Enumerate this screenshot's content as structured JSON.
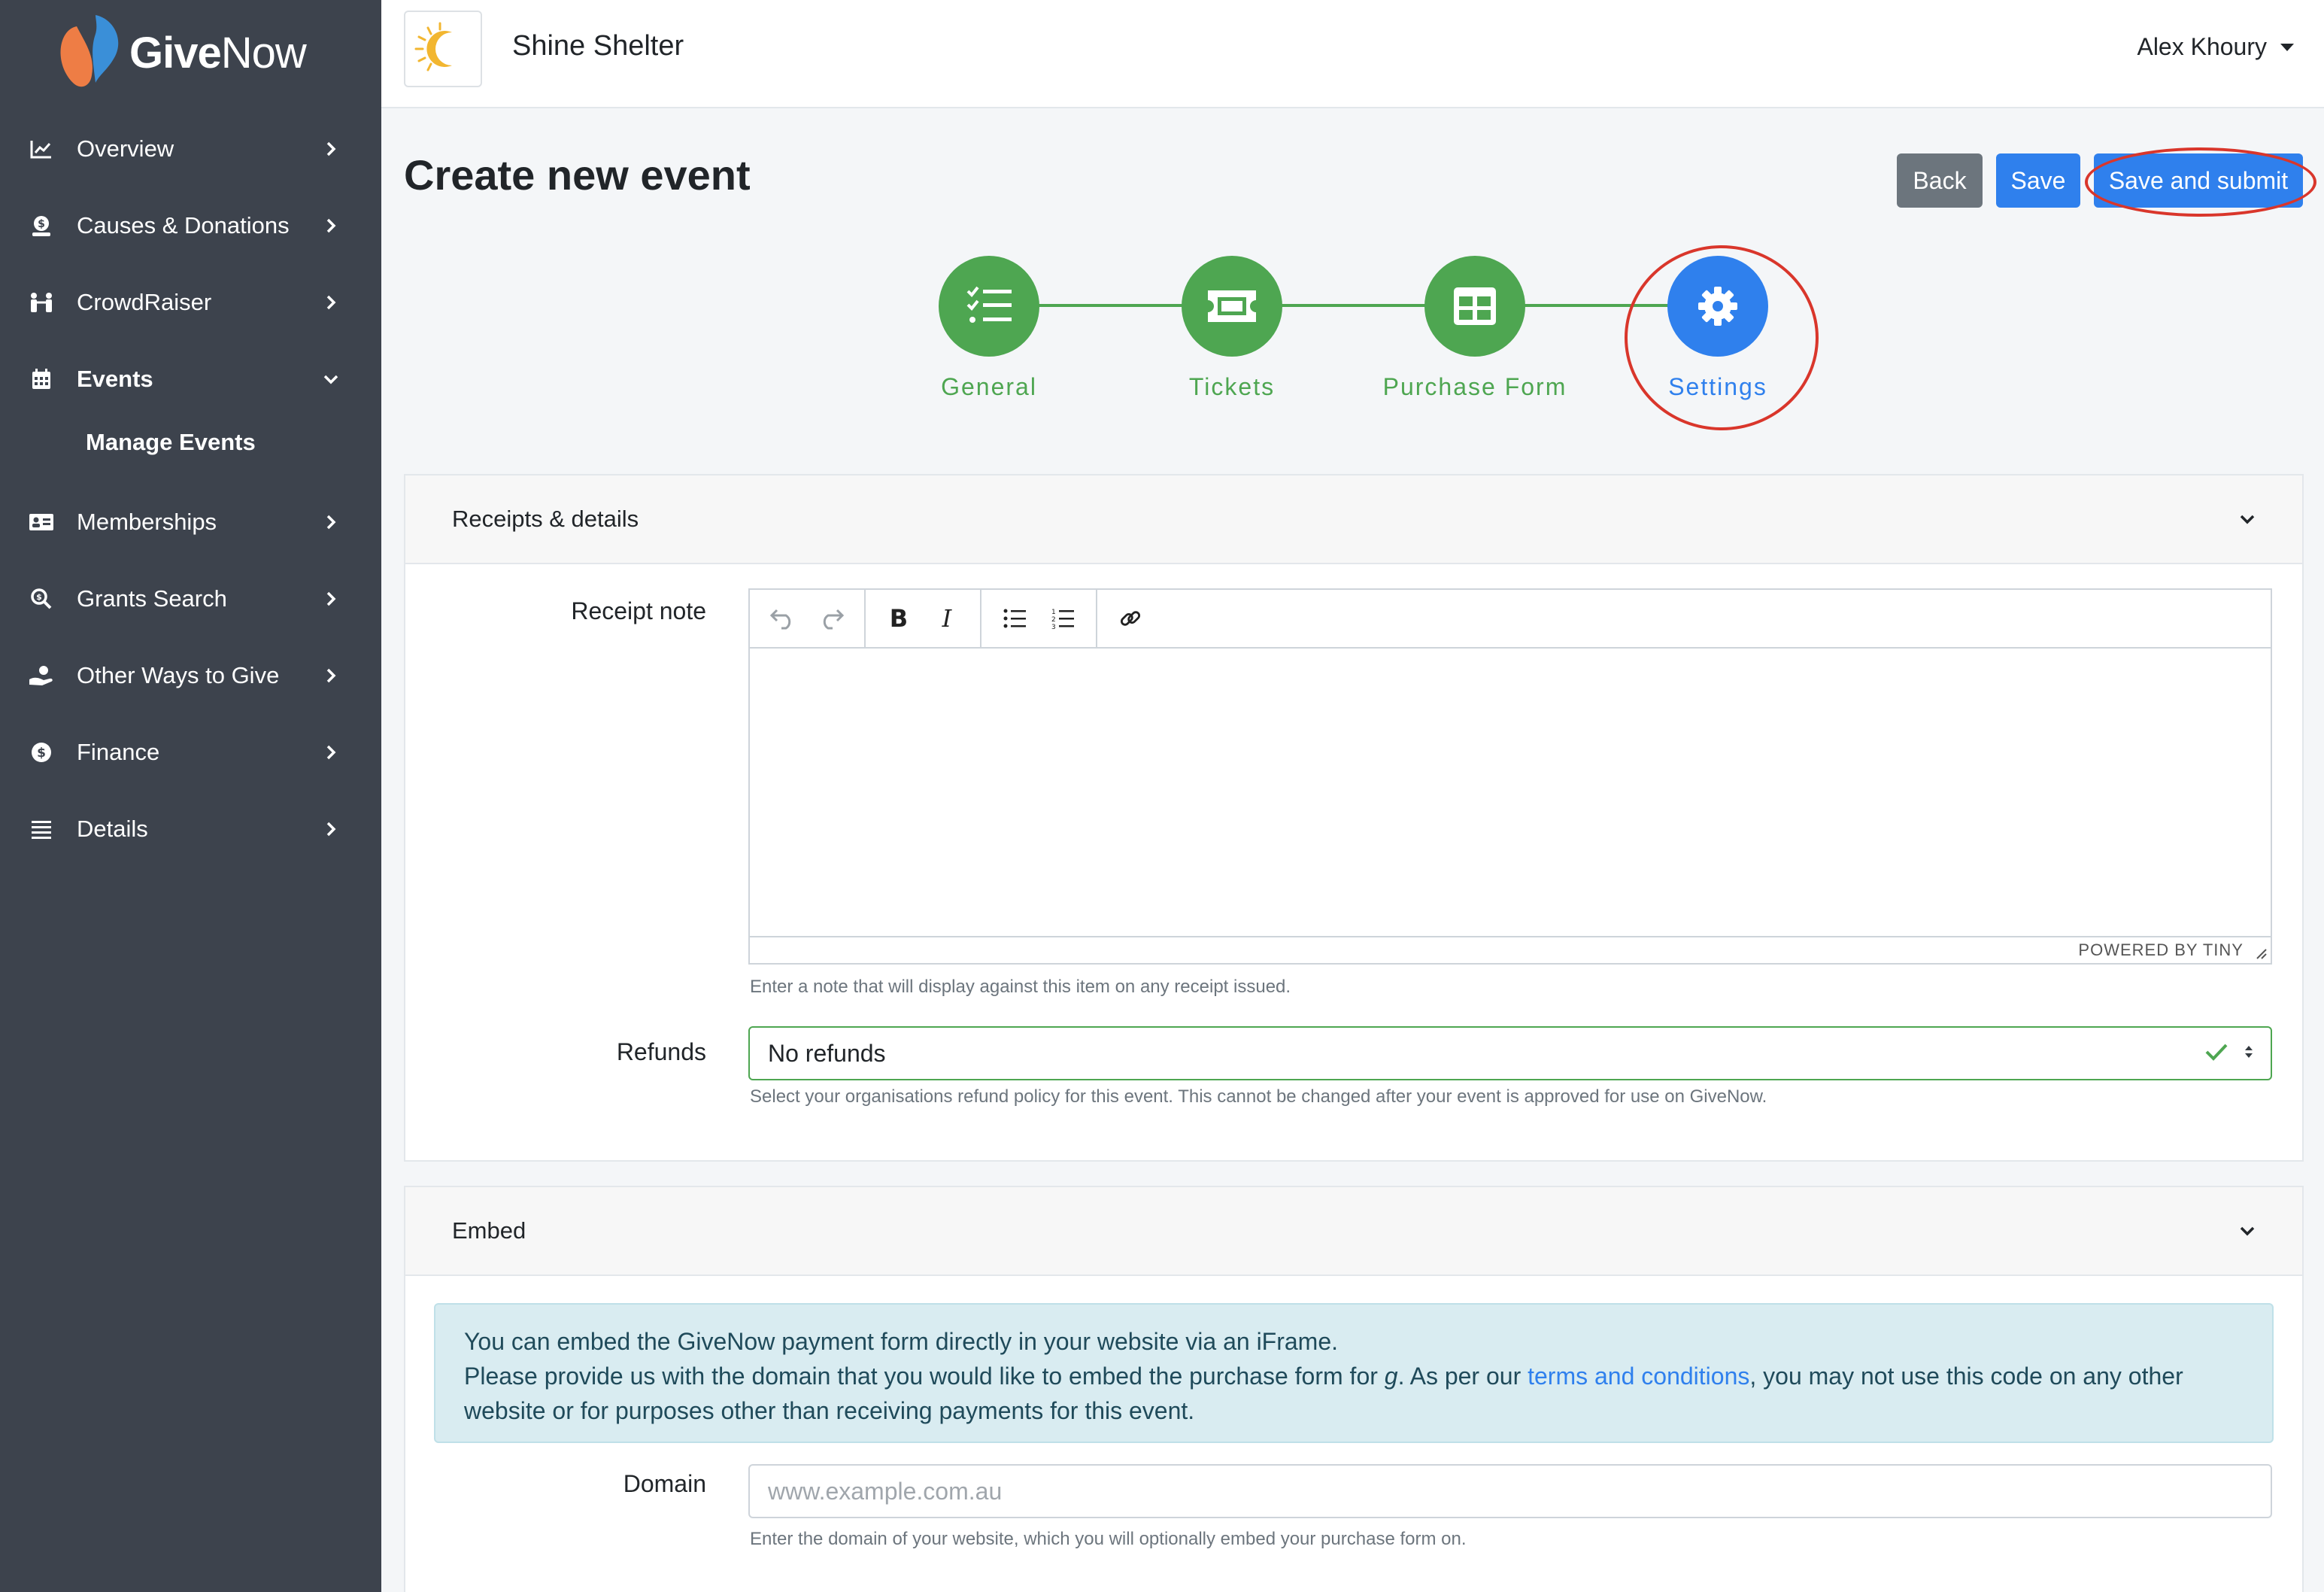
{
  "brand": {
    "name_give": "Give",
    "name_now": "Now"
  },
  "sidebar": {
    "items": [
      {
        "label": "Overview",
        "icon": "chart-line-icon"
      },
      {
        "label": "Causes & Donations",
        "icon": "donate-icon"
      },
      {
        "label": "CrowdRaiser",
        "icon": "people-icon"
      },
      {
        "label": "Events",
        "icon": "calendar-icon",
        "expanded": true
      },
      {
        "label": "Memberships",
        "icon": "id-card-icon"
      },
      {
        "label": "Grants Search",
        "icon": "search-dollar-icon"
      },
      {
        "label": "Other Ways to Give",
        "icon": "hand-holding-icon"
      },
      {
        "label": "Finance",
        "icon": "dollar-circle-icon"
      },
      {
        "label": "Details",
        "icon": "list-icon"
      }
    ],
    "sub_item": "Manage Events"
  },
  "header": {
    "org_name": "Shine Shelter",
    "user_name": "Alex Khoury"
  },
  "page": {
    "title": "Create new event",
    "buttons": {
      "back": "Back",
      "save": "Save",
      "submit": "Save and submit"
    }
  },
  "stepper": {
    "steps": [
      {
        "label": "General",
        "state": "done",
        "icon": "checklist-icon"
      },
      {
        "label": "Tickets",
        "state": "done",
        "icon": "ticket-icon"
      },
      {
        "label": "Purchase Form",
        "state": "done",
        "icon": "table-icon"
      },
      {
        "label": "Settings",
        "state": "active",
        "icon": "gear-icon"
      }
    ]
  },
  "receipts": {
    "section_title": "Receipts & details",
    "receipt_label": "Receipt note",
    "editor_status": "POWERED BY TINY",
    "receipt_help": "Enter a note that will display against this item on any receipt issued.",
    "refunds_label": "Refunds",
    "refunds_value": "No refunds",
    "refunds_help": "Select your organisations refund policy for this event. This cannot be changed after your event is approved for use on GiveNow."
  },
  "embed": {
    "section_title": "Embed",
    "info_line1": "You can embed the GiveNow payment form directly in your website via an iFrame.",
    "info_line2_a": "Please provide us with the domain that you would like to embed the purchase form for ",
    "info_line2_em": "g",
    "info_line2_b": ". As per our ",
    "info_link": "terms and conditions",
    "info_line2_c": ", you may not use this code on any other website or for purposes other than receiving payments for this event.",
    "domain_label": "Domain",
    "domain_placeholder": "www.example.com.au",
    "domain_value": "",
    "domain_help": "Enter the domain of your website, which you will optionally embed your purchase form on."
  },
  "colors": {
    "sidebar": "#3d434d",
    "primary": "#2f80ed",
    "success": "#4ea651",
    "annotation": "#d9362b"
  }
}
